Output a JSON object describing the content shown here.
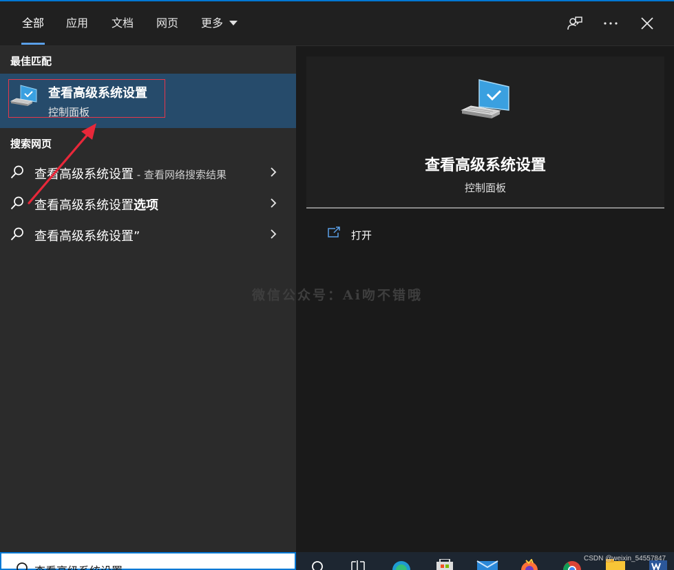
{
  "tabs": [
    {
      "label": "全部",
      "active": true
    },
    {
      "label": "应用",
      "active": false
    },
    {
      "label": "文档",
      "active": false
    },
    {
      "label": "网页",
      "active": false
    },
    {
      "label": "更多",
      "active": false
    }
  ],
  "header_icons": [
    "feedback-icon",
    "more-options-icon",
    "close-icon"
  ],
  "best_match": {
    "section_label": "最佳匹配",
    "title": "查看高级系统设置",
    "subtitle": "控制面板",
    "icon": "system-pc-icon"
  },
  "web_search": {
    "section_label": "搜索网页",
    "items": [
      {
        "text": "查看高级系统设置",
        "suffix": " - 查看网络搜索结果",
        "bold_tail": ""
      },
      {
        "text": "查看高级系统设置",
        "suffix": "",
        "bold_tail": "选项"
      },
      {
        "text": "查看高级系统设置”",
        "suffix": "",
        "bold_tail": ""
      }
    ]
  },
  "detail": {
    "title": "查看高级系统设置",
    "subtitle": "控制面板",
    "action_open": "打开"
  },
  "watermark": "微信公众号：Ai吻不错哦",
  "search_box": {
    "value": "查看高级系统设置"
  },
  "credit": "CSDN @weixin_54557847",
  "colors": {
    "accent": "#0078d4",
    "best_match_bg": "#264b6b",
    "highlight_outline": "#e8374a"
  }
}
